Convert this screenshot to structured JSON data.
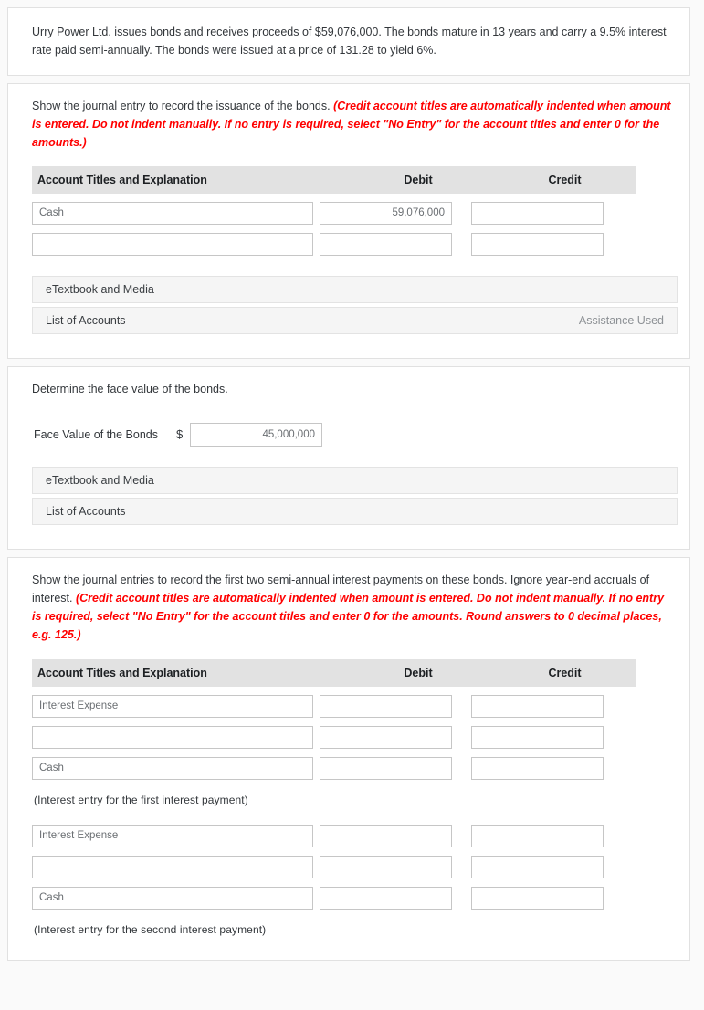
{
  "problem": {
    "text": "Urry Power Ltd. issues bonds and receives proceeds of $59,076,000. The bonds mature in 13 years and carry a 9.5% interest rate paid semi-annually. The bonds were issued at a price of 131.28 to yield 6%."
  },
  "part_a": {
    "prompt_main": "Show the journal entry to record the issuance of the bonds.",
    "prompt_note": "(Credit account titles are automatically indented when amount is entered. Do not indent manually. If no entry is required, select \"No Entry\" for the account titles and enter 0 for the amounts.)",
    "columns": {
      "account": "Account Titles and Explanation",
      "debit": "Debit",
      "credit": "Credit"
    },
    "rows": [
      {
        "account": "Cash",
        "debit": "59,076,000",
        "credit": ""
      },
      {
        "account": "",
        "debit": "",
        "credit": ""
      }
    ],
    "etextbook_label": "eTextbook and Media",
    "list_accounts_label": "List of Accounts",
    "assistance_label": "Assistance Used"
  },
  "part_b": {
    "prompt_main": "Determine the face value of the bonds.",
    "face_value_label": "Face Value of the Bonds",
    "currency_symbol": "$",
    "face_value": "45,000,000",
    "etextbook_label": "eTextbook and Media",
    "list_accounts_label": "List of Accounts"
  },
  "part_c": {
    "prompt_main": "Show the journal entries to record the first two semi-annual interest payments on these bonds. Ignore year-end accruals of interest.",
    "prompt_note": "(Credit account titles are automatically indented when amount is entered. Do not indent manually. If no entry is required, select \"No Entry\" for the account titles and enter 0 for the amounts. Round answers to 0 decimal places, e.g. 125.)",
    "columns": {
      "account": "Account Titles and Explanation",
      "debit": "Debit",
      "credit": "Credit"
    },
    "entry1": {
      "rows": [
        {
          "account": "Interest Expense",
          "debit": "",
          "credit": ""
        },
        {
          "account": "",
          "debit": "",
          "credit": ""
        },
        {
          "account": "Cash",
          "debit": "",
          "credit": ""
        }
      ],
      "caption": "(Interest entry for the first interest payment)"
    },
    "entry2": {
      "rows": [
        {
          "account": "Interest Expense",
          "debit": "",
          "credit": ""
        },
        {
          "account": "",
          "debit": "",
          "credit": ""
        },
        {
          "account": "Cash",
          "debit": "",
          "credit": ""
        }
      ],
      "caption": "(Interest entry for the second interest payment)"
    }
  },
  "colors": {
    "page_background": "#fafafa",
    "panel_background": "#ffffff",
    "table_header_background": "#e2e2e2",
    "bar_background": "#f5f5f5",
    "note_red": "#ff0000",
    "text_primary": "#33373b",
    "input_text": "#6b6f73"
  }
}
